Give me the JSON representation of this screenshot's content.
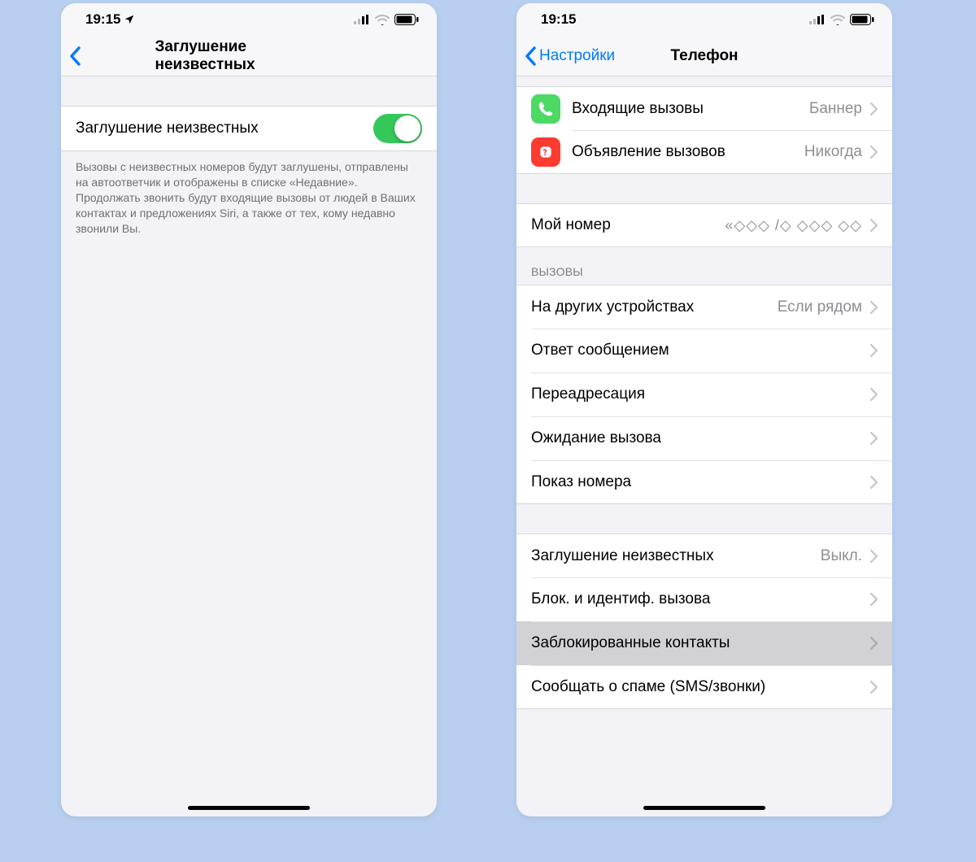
{
  "statusTime": "19:15",
  "screenA": {
    "title": "Заглушение неизвестных",
    "toggleLabel": "Заглушение неизвестных",
    "toggleOn": true,
    "footnote1": "Вызовы с неизвестных номеров будут заглушены, отправлены на автоответчик и отображены в списке «Недавние».",
    "footnote2": "Продолжать звонить будут входящие вызовы от людей в Ваших контактах и предложениях Siri, а также от тех, кому недавно звонили Вы."
  },
  "screenB": {
    "backLabel": "Настройки",
    "title": "Телефон",
    "topRows": [
      {
        "label": "Входящие вызовы",
        "value": "Баннер",
        "icon": "green"
      },
      {
        "label": "Объявление вызовов",
        "value": "Никогда",
        "icon": "red"
      }
    ],
    "myNumberLabel": "Мой номер",
    "myNumberValue": "«◇◇◇ /◇ ◇◇◇ ◇◇",
    "callsHeader": "ВЫЗОВЫ",
    "callRows": [
      {
        "label": "На других устройствах",
        "value": "Если рядом"
      },
      {
        "label": "Ответ сообщением",
        "value": ""
      },
      {
        "label": "Переадресация",
        "value": ""
      },
      {
        "label": "Ожидание вызова",
        "value": ""
      },
      {
        "label": "Показ номера",
        "value": ""
      }
    ],
    "bottomRows": [
      {
        "label": "Заглушение неизвестных",
        "value": "Выкл.",
        "sel": false
      },
      {
        "label": "Блок. и идентиф. вызова",
        "value": "",
        "sel": false
      },
      {
        "label": "Заблокированные контакты",
        "value": "",
        "sel": true
      },
      {
        "label": "Сообщать о спаме (SMS/звонки)",
        "value": "",
        "sel": false
      }
    ]
  }
}
